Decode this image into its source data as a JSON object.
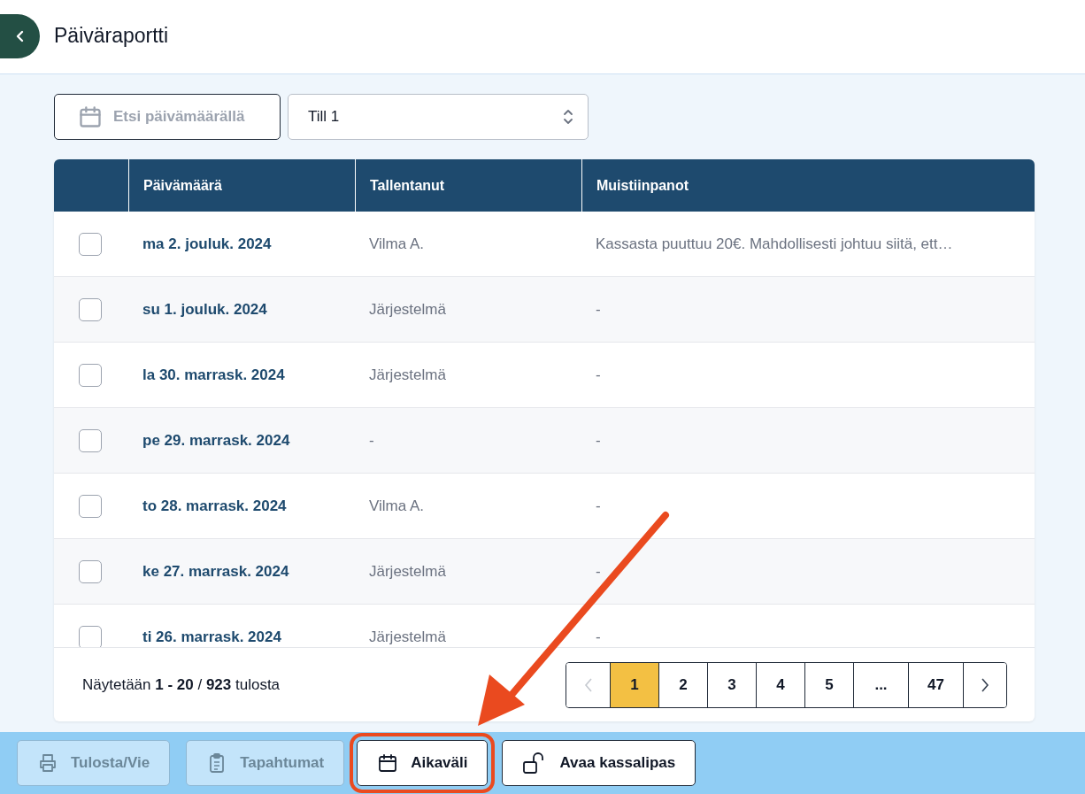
{
  "header": {
    "title": "Päiväraportti"
  },
  "filters": {
    "date_search": {
      "placeholder": "Etsi päivämäärällä"
    },
    "register_select": {
      "value": "Till 1"
    }
  },
  "table": {
    "columns": [
      "Päivämäärä",
      "Tallentanut",
      "Muistiinpanot"
    ],
    "rows": [
      {
        "checked": false,
        "date": "ma 2. jouluk. 2024",
        "recorded_by": "Vilma A.",
        "notes": "Kassasta puuttuu 20€. Mahdollisesti johtuu siitä, ett…"
      },
      {
        "checked": false,
        "date": "su 1. jouluk. 2024",
        "recorded_by": "Järjestelmä",
        "notes": "-"
      },
      {
        "checked": false,
        "date": "la 30. marrask. 2024",
        "recorded_by": "Järjestelmä",
        "notes": "-"
      },
      {
        "checked": false,
        "date": "pe 29. marrask. 2024",
        "recorded_by": "-",
        "notes": "-"
      },
      {
        "checked": false,
        "date": "to 28. marrask. 2024",
        "recorded_by": "Vilma A.",
        "notes": "-"
      },
      {
        "checked": false,
        "date": "ke 27. marrask. 2024",
        "recorded_by": "Järjestelmä",
        "notes": "-"
      },
      {
        "checked": false,
        "date": "ti 26. marrask. 2024",
        "recorded_by": "Järjestelmä",
        "notes": "-"
      }
    ]
  },
  "pagination": {
    "summary": "Näytetään **1 - 20** / **923** tulosta",
    "prev_disabled": true,
    "next_disabled": false,
    "pages": [
      {
        "label": "1",
        "selected": true
      },
      {
        "label": "2",
        "selected": false
      },
      {
        "label": "3",
        "selected": false
      },
      {
        "label": "4",
        "selected": false
      },
      {
        "label": "5",
        "selected": false
      },
      {
        "label": "...",
        "selected": false
      },
      {
        "label": "47",
        "selected": false
      }
    ]
  },
  "toolbar": [
    {
      "kind": "print",
      "label": "Tulosta/Vie",
      "disabled": true,
      "highlighted": false
    },
    {
      "kind": "events",
      "label": "Tapahtumat",
      "disabled": true,
      "highlighted": false
    },
    {
      "kind": "calendar",
      "label": "Aikaväli",
      "disabled": false,
      "highlighted": true
    },
    {
      "kind": "lock",
      "label": "Avaa kassalipas",
      "disabled": false,
      "highlighted": false
    }
  ]
}
